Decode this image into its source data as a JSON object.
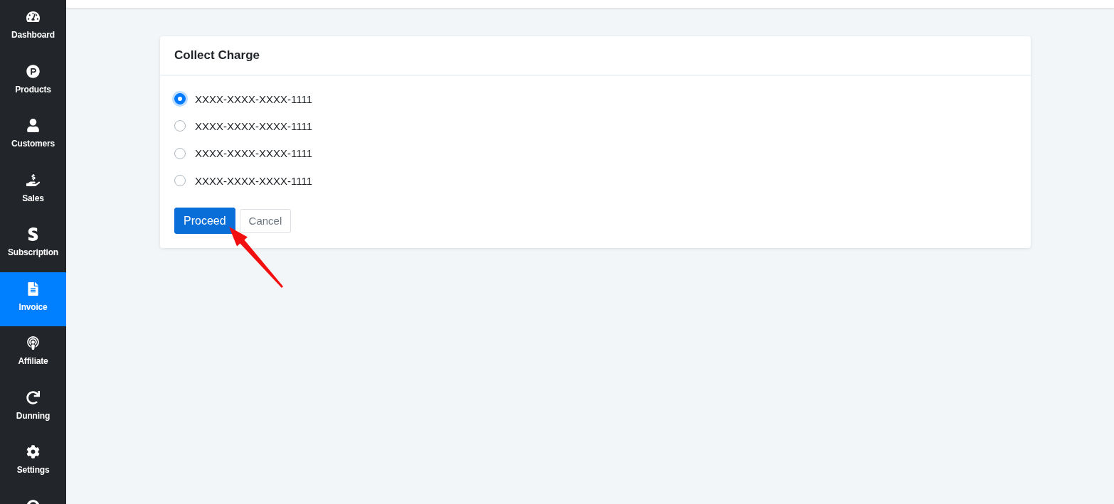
{
  "sidebar": {
    "items": [
      {
        "label": "Dashboard",
        "selected": false
      },
      {
        "label": "Products",
        "selected": false
      },
      {
        "label": "Customers",
        "selected": false
      },
      {
        "label": "Sales",
        "selected": false
      },
      {
        "label": "Subscription",
        "selected": false
      },
      {
        "label": "Invoice",
        "selected": true
      },
      {
        "label": "Affiliate",
        "selected": false
      },
      {
        "label": "Dunning",
        "selected": false
      },
      {
        "label": "Settings",
        "selected": false
      },
      {
        "selected": false
      }
    ]
  },
  "card": {
    "title": "Collect Charge",
    "options": [
      {
        "label": "XXXX-XXXX-XXXX-1111",
        "selected": true
      },
      {
        "label": "XXXX-XXXX-XXXX-1111",
        "selected": false
      },
      {
        "label": "XXXX-XXXX-XXXX-1111",
        "selected": false
      },
      {
        "label": "XXXX-XXXX-XXXX-1111",
        "selected": false
      }
    ],
    "buttons": [
      {
        "label": "Proceed",
        "kind": "primary"
      },
      {
        "label": "Cancel",
        "kind": "secondary"
      }
    ]
  }
}
